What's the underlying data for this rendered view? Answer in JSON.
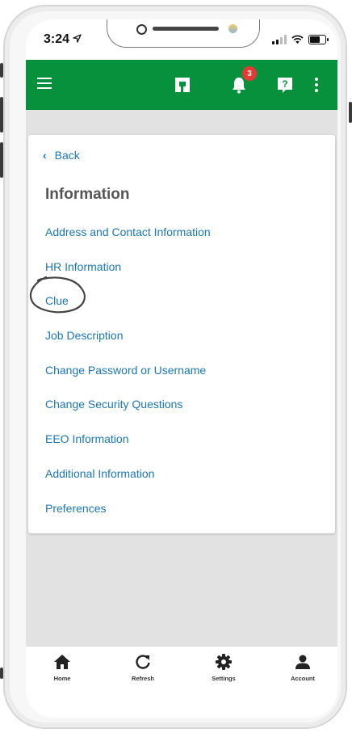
{
  "status_bar": {
    "time": "3:24",
    "location_icon": "location-arrow-icon",
    "icons": [
      "signal-icon",
      "wifi-icon",
      "battery-icon"
    ]
  },
  "app_bar": {
    "color": "#07913d",
    "menu_icon": "hamburger-menu-icon",
    "logo_icon": "app-logo-icon",
    "notification_count": "3",
    "help_icon": "help-icon",
    "more_icon": "more-vertical-icon"
  },
  "card": {
    "back_label": "Back",
    "title": "Information",
    "items": [
      {
        "label": "Address and Contact Information"
      },
      {
        "label": "HR Information"
      },
      {
        "label": "Clue"
      },
      {
        "label": "Job Description"
      },
      {
        "label": "Change Password or Username"
      },
      {
        "label": "Change Security Questions"
      },
      {
        "label": "EEO Information"
      },
      {
        "label": "Additional Information"
      },
      {
        "label": "Preferences"
      }
    ],
    "link_color": "#1b77b5"
  },
  "bottom_nav": {
    "items": [
      {
        "label": "Home",
        "icon": "home-icon"
      },
      {
        "label": "Refresh",
        "icon": "refresh-icon"
      },
      {
        "label": "Settings",
        "icon": "gear-icon"
      },
      {
        "label": "Account",
        "icon": "account-icon"
      }
    ]
  }
}
